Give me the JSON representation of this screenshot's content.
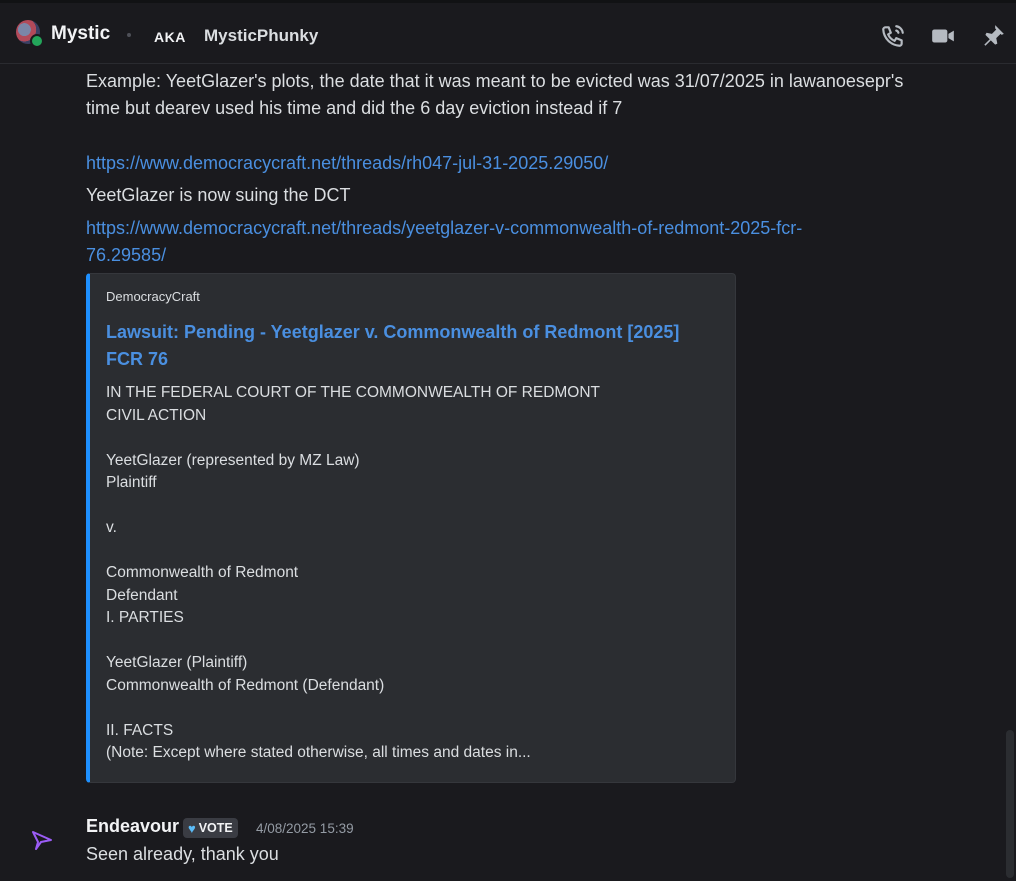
{
  "header": {
    "title": "Mystic",
    "aka_label": "AKA",
    "aka_name": "MysticPhunky",
    "icons": [
      "call-icon",
      "video-icon",
      "pin-icon"
    ]
  },
  "message1": {
    "line1": "Example: YeetGlazer's plots, the date that it was meant to be evicted was 31/07/2025 in lawanoesepr's",
    "line2": "time but dearev used his time and did the 6 day eviction instead if 7",
    "link1": "https://www.democracycraft.net/threads/rh047-jul-31-2025.29050/",
    "line3": "YeetGlazer is now suing the DCT",
    "link2_line1": "https://www.democracycraft.net/threads/yeetglazer-v-commonwealth-of-redmont-2025-fcr-",
    "link2_line2": "76.29585/"
  },
  "embed": {
    "provider": "DemocracyCraft",
    "title": "Lawsuit: Pending - Yeetglazer v. Commonwealth of Redmont [2025] FCR 76",
    "description": "IN THE FEDERAL COURT OF THE COMMONWEALTH OF REDMONT\nCIVIL ACTION\n\nYeetGlazer (represented by MZ Law)\nPlaintiff\n\nv.\n\nCommonwealth of Redmont\nDefendant\nI. PARTIES\n\nYeetGlazer (Plaintiff)\nCommonwealth of Redmont (Defendant)\n\nII. FACTS\n(Note: Except where stated otherwise, all times and dates in...",
    "accent_color": "#1e90ff"
  },
  "message2": {
    "author": "Endeavour",
    "role_badge": "VOTE",
    "timestamp": "4/08/2025 15:39",
    "text": "Seen already, thank you"
  },
  "colors": {
    "background": "#1a1a1e",
    "link": "#4a8fe0",
    "embed_bg": "#2b2d31",
    "online": "#23a55a"
  }
}
